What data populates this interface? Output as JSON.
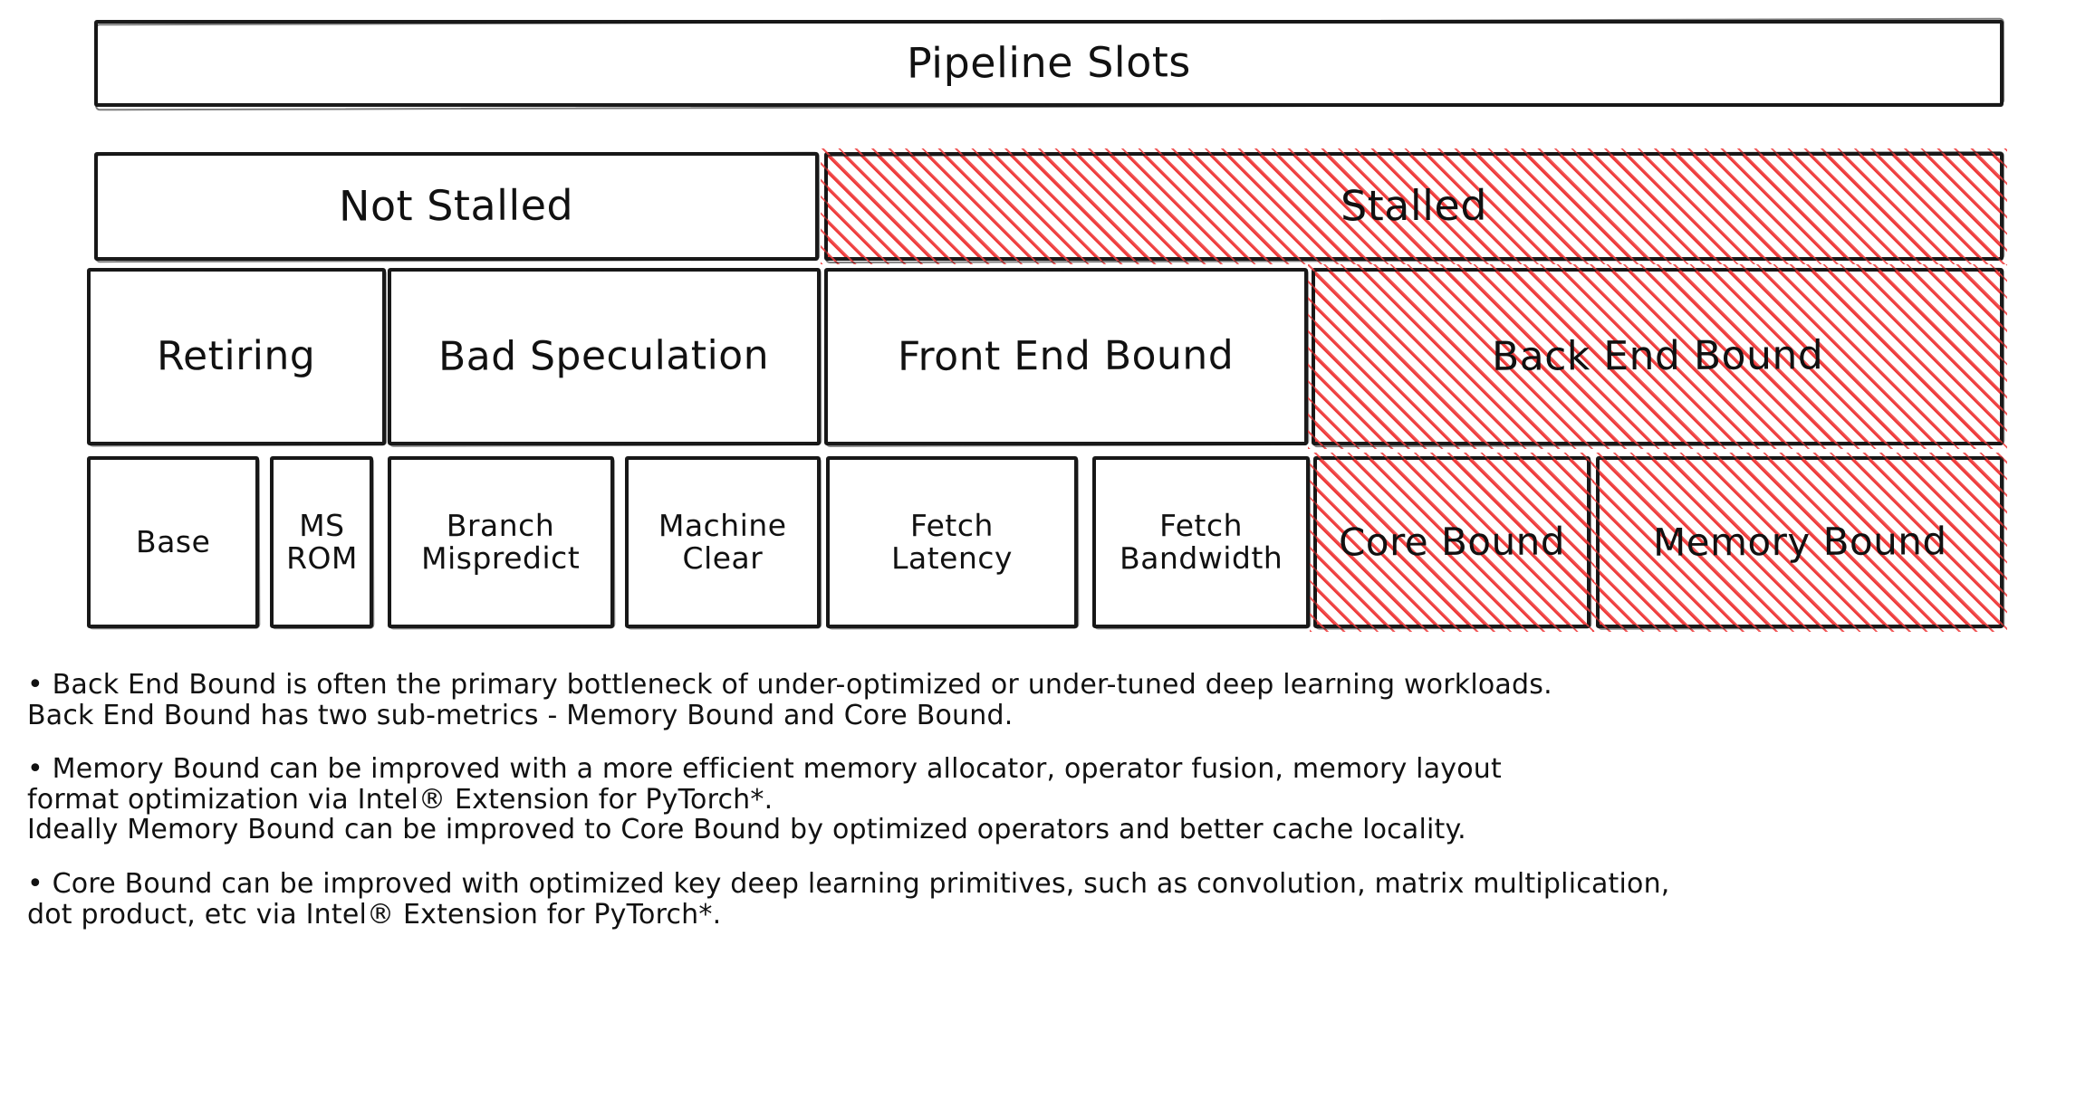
{
  "diagram": {
    "title": "Top-Down Microarchitecture Analysis hierarchy",
    "colors": {
      "stroke": "#1a1a1a",
      "hatch_red": "#ef3b3b",
      "background": "#ffffff",
      "text": "#111111"
    },
    "rows": [
      {
        "name": "level-0",
        "boxes": [
          {
            "label": "Pipeline Slots",
            "hatched": false
          }
        ]
      },
      {
        "name": "level-1",
        "boxes": [
          {
            "label": "Not Stalled",
            "hatched": false
          },
          {
            "label": "Stalled",
            "hatched": true
          }
        ]
      },
      {
        "name": "level-2",
        "boxes": [
          {
            "label": "Retiring",
            "hatched": false
          },
          {
            "label": "Bad Speculation",
            "hatched": false
          },
          {
            "label": "Front End Bound",
            "hatched": false
          },
          {
            "label": "Back End Bound",
            "hatched": true
          }
        ]
      },
      {
        "name": "level-3",
        "boxes": [
          {
            "label": "Base",
            "hatched": false
          },
          {
            "label": "MS\nROM",
            "hatched": false
          },
          {
            "label": "Branch\nMispredict",
            "hatched": false
          },
          {
            "label": "Machine\nClear",
            "hatched": false
          },
          {
            "label": "Fetch\nLatency",
            "hatched": false
          },
          {
            "label": "Fetch\nBandwidth",
            "hatched": false
          },
          {
            "label": "Core Bound",
            "hatched": true
          },
          {
            "label": "Memory Bound",
            "hatched": true
          }
        ]
      }
    ]
  },
  "notes": {
    "bullets": [
      "• Back End Bound is often the primary bottleneck of under-optimized or under-tuned deep learning workloads.\nBack End Bound has two sub-metrics - Memory Bound and Core Bound.",
      "• Memory Bound can be improved with a more efficient memory allocator, operator fusion, memory layout\nformat optimization via Intel® Extension for PyTorch*.\nIdeally Memory Bound can be improved to Core Bound by optimized operators and better cache locality.",
      "• Core Bound can be improved with optimized key deep learning primitives, such as convolution, matrix multiplication,\ndot product, etc via Intel® Extension for PyTorch*."
    ]
  }
}
